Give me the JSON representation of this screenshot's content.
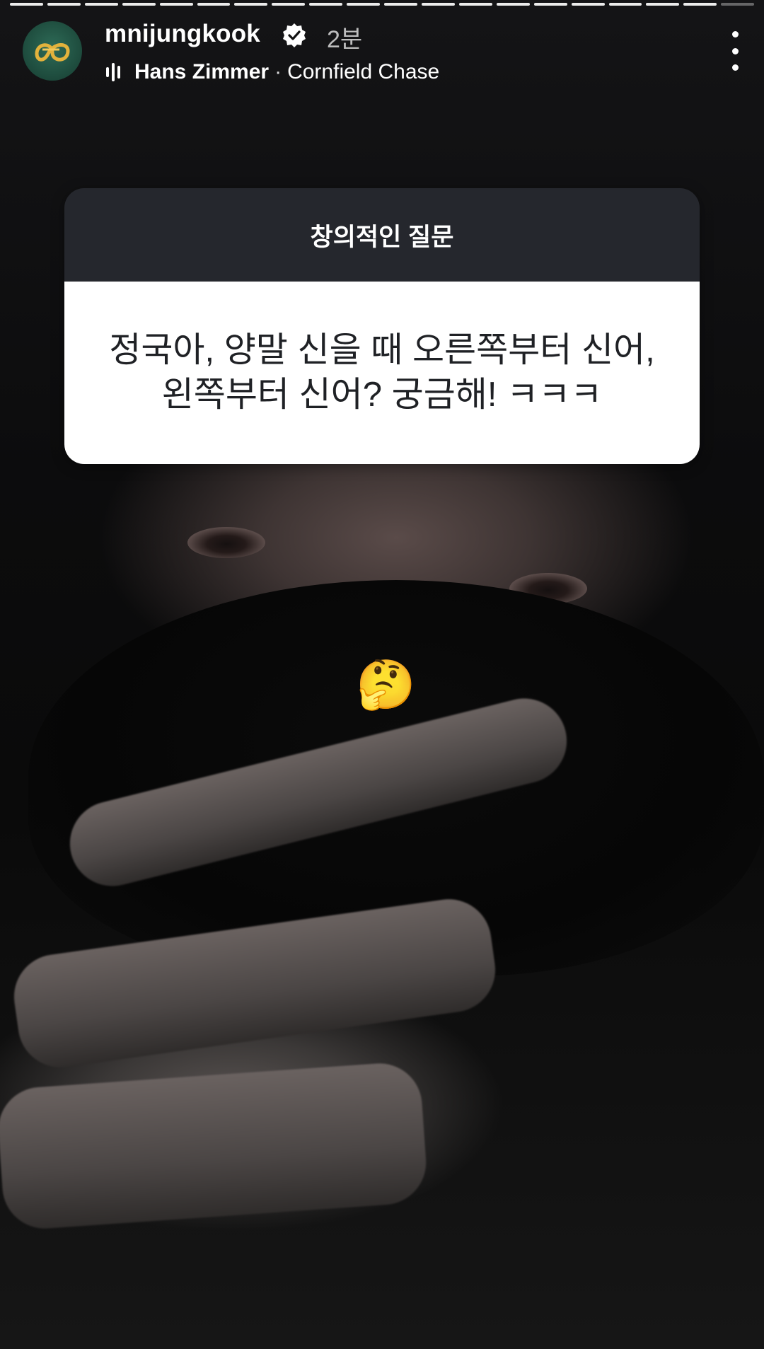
{
  "story": {
    "progress_segments": 20,
    "seen_segments": 19
  },
  "header": {
    "username": "mnijungkook",
    "verified_icon": "verified-badge-icon",
    "time": "2분",
    "music": {
      "icon": "equalizer-icon",
      "artist": "Hans Zimmer",
      "separator": "·",
      "track": "Cornfield Chase"
    },
    "more_icon": "more-vertical-icon"
  },
  "question_sticker": {
    "title": "창의적인 질문",
    "line1": "정국아, 양말 신을 때 오른쪽부터 신어,",
    "line2": "왼쪽부터 신어? 궁금해! ㅋㅋㅋ"
  },
  "emoji_sticker": {
    "emoji": "🤔"
  }
}
